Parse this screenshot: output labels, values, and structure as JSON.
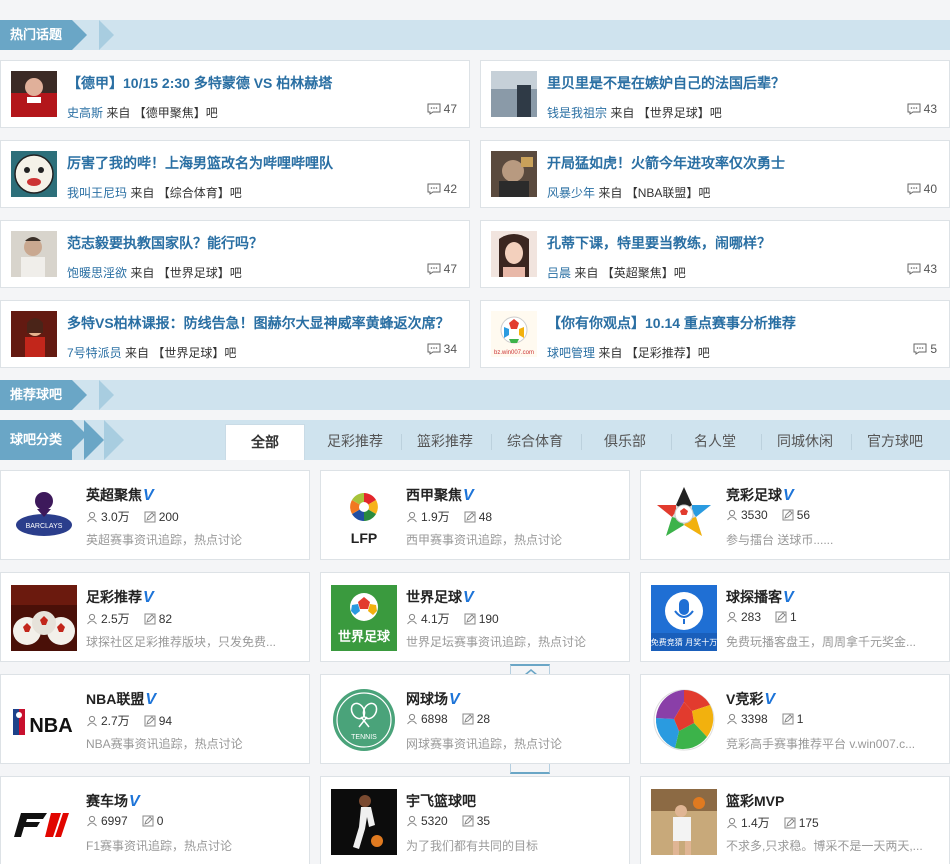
{
  "sections": {
    "hot": "热门话题",
    "recommend": "推荐球吧",
    "category": "球吧分类"
  },
  "topic_from": "来自",
  "topics": [
    {
      "title": "【德甲】10/15 2:30 多特蒙德 VS 柏林赫塔",
      "user": "史高斯",
      "bar": "【德甲聚焦】吧",
      "count": "47"
    },
    {
      "title": "里贝里是不是在嫉妒自己的法国后辈？",
      "user": "钱是我祖宗",
      "bar": "【世界足球】吧",
      "count": "43"
    },
    {
      "title": "厉害了我的哔！上海男篮改名为哔哩哔哩队",
      "user": "我叫王尼玛",
      "bar": "【综合体育】吧",
      "count": "42"
    },
    {
      "title": "开局猛如虎！火箭今年进攻率仅次勇士",
      "user": "风暴少年",
      "bar": "【NBA联盟】吧",
      "count": "40"
    },
    {
      "title": "范志毅要执教国家队？能行吗？",
      "user": "饱暖思淫欲",
      "bar": "【世界足球】吧",
      "count": "47"
    },
    {
      "title": "孔蒂下课，特里要当教练，闹哪样？",
      "user": "吕晨",
      "bar": "【英超聚焦】吧",
      "count": "43"
    },
    {
      "title": "多特VS柏林课报：防线告急！图赫尔大显神威率黄蜂返次席？",
      "user": "7号特派员",
      "bar": "【世界足球】吧",
      "count": "34"
    },
    {
      "title": "【你有你观点】10.14 重点赛事分析推荐",
      "user": "球吧管理",
      "bar": "【足彩推荐】吧",
      "count": "5"
    }
  ],
  "tabs": [
    "全部",
    "足彩推荐",
    "篮彩推荐",
    "综合体育",
    "俱乐部",
    "名人堂",
    "同城休闲",
    "官方球吧"
  ],
  "logo_texts": {
    "lfp": "LFP",
    "world": "世界足球",
    "nba": "NBA",
    "tennis": "TENNIS",
    "f1": "F1",
    "win007": "bz.win007.com",
    "mic": "免费竞猜 月奖十万"
  },
  "cards": [
    {
      "name": "英超聚焦",
      "v": "V",
      "members": "3.0万",
      "posts": "200",
      "desc": "英超赛事资讯追踪，热点讨论"
    },
    {
      "name": "西甲聚焦",
      "v": "V",
      "members": "1.9万",
      "posts": "48",
      "desc": "西甲赛事资讯追踪，热点讨论"
    },
    {
      "name": "竞彩足球",
      "v": "V",
      "members": "3530",
      "posts": "56",
      "desc": "参与擂台 送球币......"
    },
    {
      "name": "足彩推荐",
      "v": "V",
      "members": "2.5万",
      "posts": "82",
      "desc": "球探社区足彩推荐版块，只发免费..."
    },
    {
      "name": "世界足球",
      "v": "V",
      "members": "4.1万",
      "posts": "190",
      "desc": "世界足坛赛事资讯追踪，热点讨论"
    },
    {
      "name": "球探播客",
      "v": "V",
      "members": "283",
      "posts": "1",
      "desc": "免费玩播客盘王，周周拿千元奖金..."
    },
    {
      "name": "NBA联盟",
      "v": "V",
      "members": "2.7万",
      "posts": "94",
      "desc": "NBA赛事资讯追踪，热点讨论"
    },
    {
      "name": "网球场",
      "v": "V",
      "members": "6898",
      "posts": "28",
      "desc": "网球赛事资讯追踪，热点讨论"
    },
    {
      "name": "V竞彩",
      "v": "V",
      "members": "3398",
      "posts": "1",
      "desc": "竞彩高手赛事推荐平台 v.win007.c..."
    },
    {
      "name": "赛车场",
      "v": "V",
      "members": "6997",
      "posts": "0",
      "desc": "F1赛事资讯追踪，热点讨论"
    },
    {
      "name": "宇飞篮球吧",
      "v": "",
      "members": "5320",
      "posts": "35",
      "desc": "为了我们都有共同的目标"
    },
    {
      "name": "篮彩MVP",
      "v": "",
      "members": "1.4万",
      "posts": "175",
      "desc": "不求多,只求稳。博采不是一天两天,..."
    }
  ]
}
